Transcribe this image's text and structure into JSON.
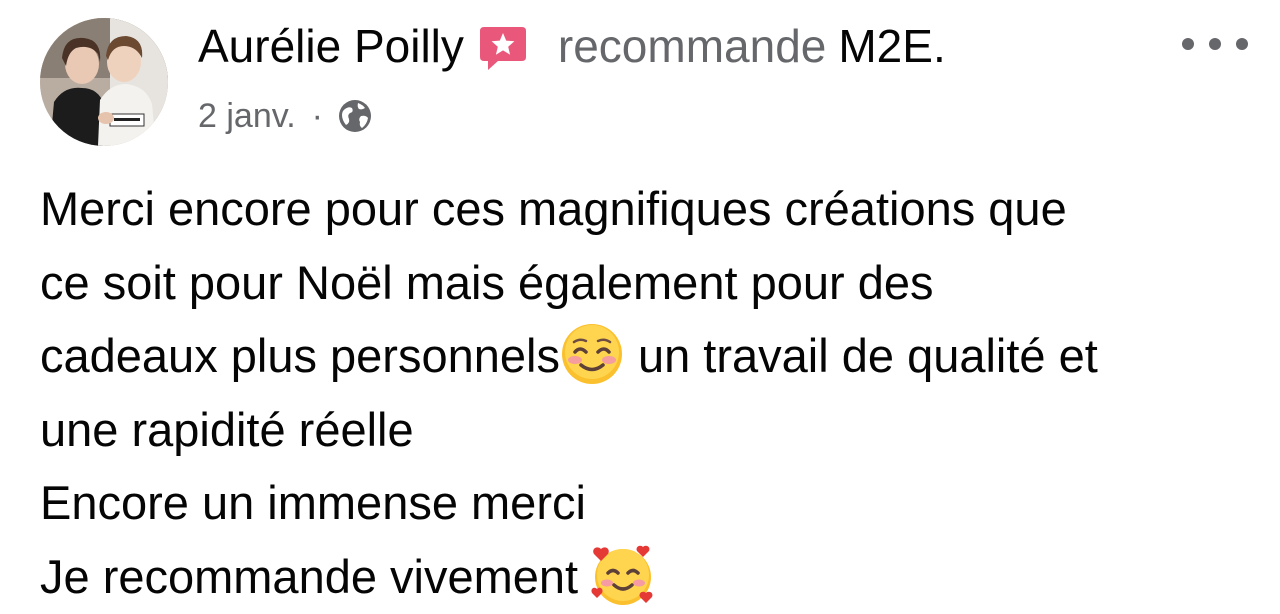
{
  "post": {
    "author": "Aurélie Poilly",
    "action": "recommande",
    "page": "M2E",
    "page_suffix": ".",
    "date": "2 janv.",
    "separator": "·",
    "body_lines": [
      "Merci encore pour ces magnifiques créations que",
      "ce soit pour Noël mais également pour des",
      "cadeaux plus personnels",
      "un travail de qualité et",
      "une rapidité réelle",
      "Encore un immense merci",
      "Je recommande vivement"
    ]
  },
  "icons": {
    "recommend": "recommend-badge-icon",
    "more": "more-options-icon",
    "audience": "globe-public-icon",
    "emoji_1": "smiling-face-with-smiling-eyes-emoji",
    "emoji_2": "smiling-face-with-hearts-emoji"
  },
  "colors": {
    "text_primary": "#050505",
    "text_secondary": "#65676b",
    "recommend_badge": "#e9587a",
    "background": "#ffffff"
  }
}
